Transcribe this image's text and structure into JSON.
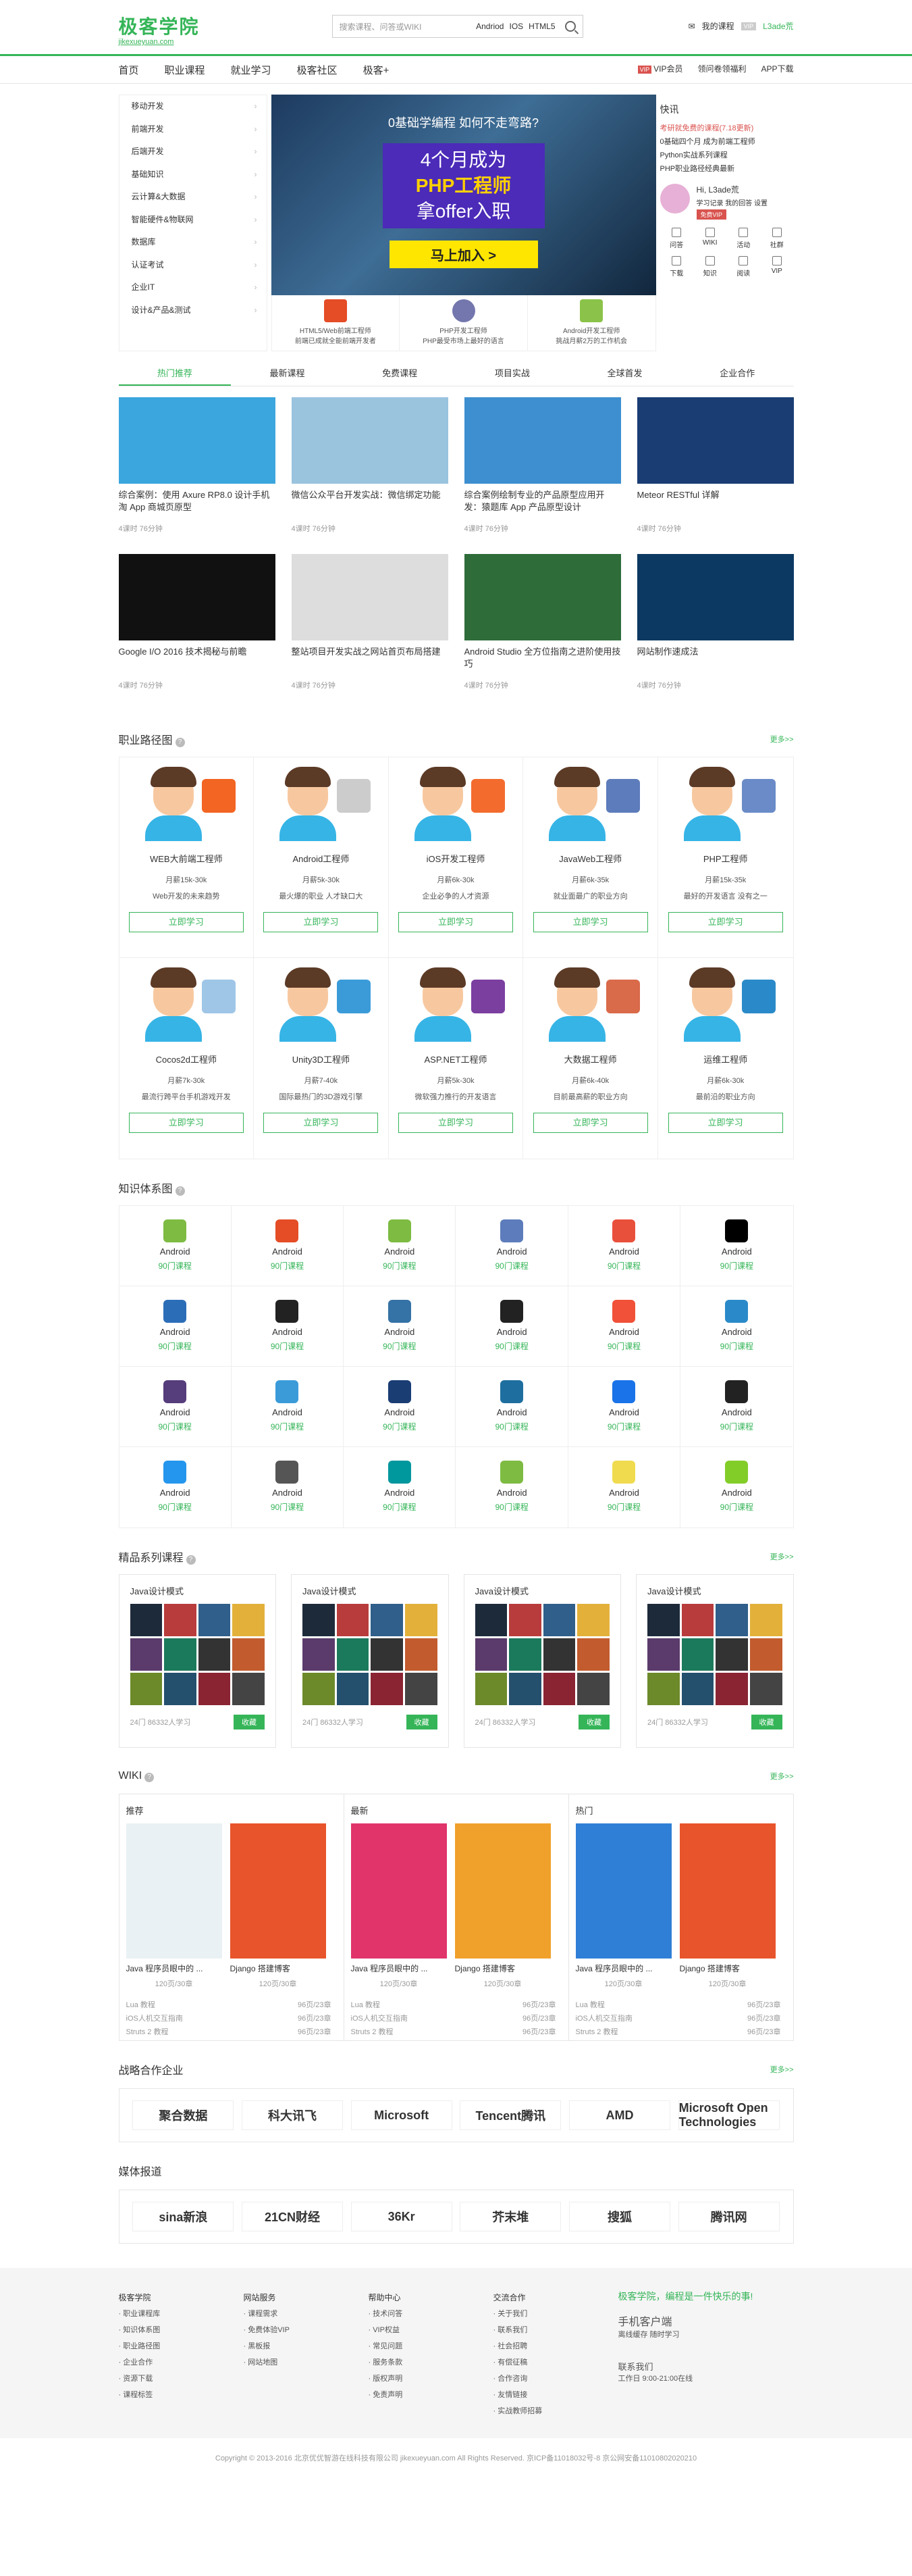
{
  "header": {
    "logo": "极客学院",
    "logo_sub": "jikexueyuan.com",
    "search_placeholder": "搜索课程、问答或WIKI",
    "search_tags": [
      "Andriod",
      "IOS",
      "HTML5"
    ],
    "msg": "我的课程",
    "vip_badge": "VIP",
    "username": "L3ade荒"
  },
  "nav": {
    "items": [
      "首页",
      "职业课程",
      "就业学习",
      "极客社区",
      "极客+"
    ],
    "vip": "VIP会员",
    "vip_tag": "VIP",
    "wallet": "领问卷领福利",
    "app": "APP下载"
  },
  "categories": [
    "移动开发",
    "前端开发",
    "后端开发",
    "基础知识",
    "云计算&大数据",
    "智能硬件&物联网",
    "数据库",
    "认证考试",
    "企业IT",
    "设计&产品&测试"
  ],
  "banner": {
    "line1": "0基础学编程 如何不走弯路?",
    "line2a": "4个月成为",
    "line2b": "PHP工程师",
    "line2c": "拿offer入职",
    "button": "马上加入 >",
    "cards": [
      {
        "title": "HTML5/Web前端工程师",
        "sub": "前端已成就全能前端开发者"
      },
      {
        "title": "PHP开发工程师",
        "sub": "PHP最受市场上最好的语言"
      },
      {
        "title": "Android开发工程师",
        "sub": "挑战月薪2万的工作机会"
      }
    ]
  },
  "kuaixun": {
    "title": "快讯",
    "items": [
      "考研就免费的课程(7.18更新)",
      "0基础四个月 成为前端工程师",
      "Python实战系列课程",
      "PHP职业路径经典最新"
    ],
    "hi": "Hi, L3ade荒",
    "links": "学习记录 我的回答 设置",
    "vip_btn": "免费VIP",
    "quick": [
      "问答",
      "WIKI",
      "活动",
      "社群",
      "下载",
      "知识",
      "阅读",
      "VIP"
    ]
  },
  "tabs": [
    "热门推荐",
    "最新课程",
    "免费课程",
    "项目实战",
    "全球首发",
    "企业合作"
  ],
  "courses": [
    {
      "title": "综合案例：使用 Axure RP8.0 设计手机淘 App 商城页原型",
      "meta": "4课时   76分钟"
    },
    {
      "title": "微信公众平台开发实战：微信绑定功能",
      "meta": "4课时   76分钟"
    },
    {
      "title": "综合案例绘制专业的产品原型应用开发：猿题库 App 产品原型设计",
      "meta": "4课时   76分钟"
    },
    {
      "title": "Meteor RESTful 详解",
      "meta": "4课时   76分钟"
    },
    {
      "title": "Google I/O 2016 技术揭秘与前瞻",
      "meta": "4课时   76分钟"
    },
    {
      "title": "整站项目开发实战之网站首页布局搭建",
      "meta": "4课时   76分钟"
    },
    {
      "title": "Android Studio 全方位指南之进阶使用技巧",
      "meta": "4课时   76分钟"
    },
    {
      "title": "网站制作速成法",
      "meta": "4课时   76分钟"
    }
  ],
  "paths_title": "职业路径图",
  "more": "更多>>",
  "paths": [
    {
      "name": "WEB大前端工程师",
      "salary": "月薪15k-30k",
      "desc": "Web开发的未来趋势",
      "btn": "立即学习"
    },
    {
      "name": "Android工程师",
      "salary": "月薪5k-30k",
      "desc": "最火爆的职业 人才缺口大",
      "btn": "立即学习"
    },
    {
      "name": "iOS开发工程师",
      "salary": "月薪6k-30k",
      "desc": "企业必争的人才资源",
      "btn": "立即学习"
    },
    {
      "name": "JavaWeb工程师",
      "salary": "月薪6k-35k",
      "desc": "就业面最广的职业方向",
      "btn": "立即学习"
    },
    {
      "name": "PHP工程师",
      "salary": "月薪15k-35k",
      "desc": "最好的开发语言 没有之一",
      "btn": "立即学习"
    },
    {
      "name": "Cocos2d工程师",
      "salary": "月薪7k-30k",
      "desc": "最流行跨平台手机游戏开发",
      "btn": "立即学习"
    },
    {
      "name": "Unity3D工程师",
      "salary": "月薪7-40k",
      "desc": "国际最热门的3D游戏引擎",
      "btn": "立即学习"
    },
    {
      "name": "ASP.NET工程师",
      "salary": "月薪5k-30k",
      "desc": "微软强力推行的开发语言",
      "btn": "立即学习"
    },
    {
      "name": "大数据工程师",
      "salary": "月薪6k-40k",
      "desc": "目前最高薪的职业方向",
      "btn": "立即学习"
    },
    {
      "name": "运维工程师",
      "salary": "月薪6k-30k",
      "desc": "最前沿的职业方向",
      "btn": "立即学习"
    }
  ],
  "knowledge_title": "知识体系图",
  "knowledge": {
    "label": "Android",
    "count": "90门课程"
  },
  "series_title": "精品系列课程",
  "series": [
    {
      "title": "Java设计模式",
      "meta": "24门  86332人学习",
      "btn": "收藏"
    },
    {
      "title": "Java设计模式",
      "meta": "24门  86332人学习",
      "btn": "收藏"
    },
    {
      "title": "Java设计模式",
      "meta": "24门  86332人学习",
      "btn": "收藏"
    },
    {
      "title": "Java设计模式",
      "meta": "24门  86332人学习",
      "btn": "收藏"
    }
  ],
  "wiki_title": "WIKI",
  "wiki": [
    {
      "label": "推荐",
      "books": [
        {
          "name": "Java 程序员眼中的 ...",
          "stat": "120页/30章"
        },
        {
          "name": "Django 搭建博客",
          "stat": "120页/30章"
        }
      ]
    },
    {
      "label": "最新",
      "books": [
        {
          "name": "Java 程序员眼中的 ...",
          "stat": "120页/30章"
        },
        {
          "name": "Django 搭建博客",
          "stat": "120页/30章"
        }
      ]
    },
    {
      "label": "热门",
      "books": [
        {
          "name": "Java 程序员眼中的 ...",
          "stat": "120页/30章"
        },
        {
          "name": "Django 搭建博客",
          "stat": "120页/30章"
        }
      ]
    }
  ],
  "wiki_list": [
    [
      "Lua 教程",
      "96页/23章"
    ],
    [
      "iOS人机交互指南",
      "96页/23章"
    ],
    [
      "Struts 2 教程",
      "96页/23章"
    ]
  ],
  "partners_title": "战略合作企业",
  "partners": [
    "聚合数据",
    "科大讯飞",
    "Microsoft",
    "Tencent腾讯",
    "AMD",
    "Microsoft Open Technologies"
  ],
  "media_title": "媒体报道",
  "media": [
    "sina新浪",
    "21CN财经",
    "36Kr",
    "芥末堆",
    "搜狐",
    "腾讯网"
  ],
  "footer": {
    "cols": [
      {
        "title": "极客学院",
        "items": [
          "职业课程库",
          "知识体系图",
          "职业路径图",
          "企业合作",
          "资源下载",
          "课程标签"
        ]
      },
      {
        "title": "网站服务",
        "items": [
          "课程需求",
          "免费体验VIP",
          "黑板报",
          "网站地图"
        ]
      },
      {
        "title": "帮助中心",
        "items": [
          "技术问答",
          "VIP权益",
          "常见问题",
          "服务条款",
          "版权声明",
          "免责声明"
        ]
      },
      {
        "title": "交流合作",
        "items": [
          "关于我们",
          "联系我们",
          "社会招聘",
          "有偿征稿",
          "合作咨询",
          "友情链接",
          "实战教师招募"
        ]
      }
    ],
    "slogan": "极客学院，编程是一件快乐的事!",
    "app_title": "手机客户端",
    "app_sub": "离线缓存 随时学习",
    "contact_title": "联系我们",
    "contact_hours": "工作日 9:00-21:00在线"
  },
  "copyright": "Copyright © 2013-2016 北京优优智游在线科技有限公司 jikexueyuan.com All Rights Reserved. 京ICP备11018032号-8 京公网安备11010802020210"
}
